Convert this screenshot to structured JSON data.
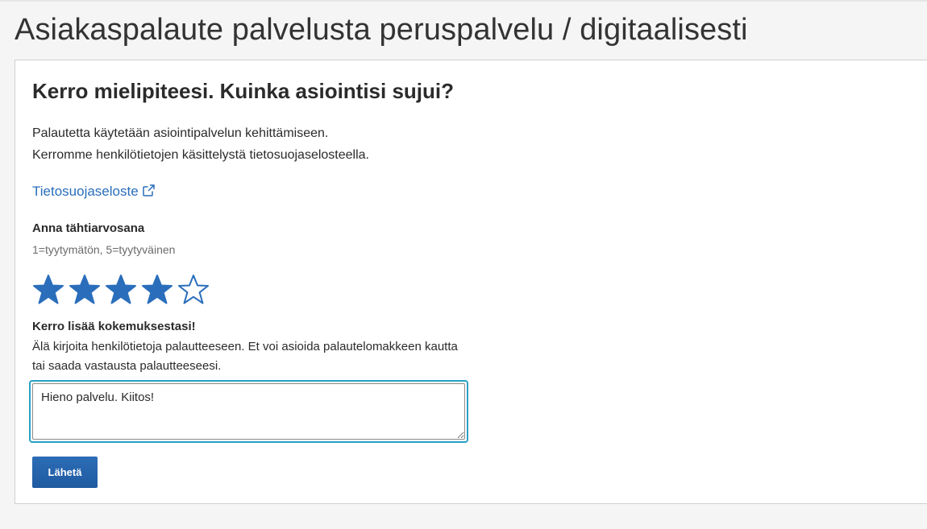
{
  "page": {
    "title": "Asiakaspalaute palvelusta peruspalvelu / digitaalisesti"
  },
  "form": {
    "heading": "Kerro mielipiteesi. Kuinka asiointisi sujui?",
    "intro_lines": [
      "Palautetta käytetään asiointipalvelun kehittämiseen.",
      "Kerromme henkilötietojen käsittelystä tietosuojaselosteella."
    ],
    "privacy_link": "Tietosuojaseloste",
    "rating": {
      "label": "Anna tähtiarvosana",
      "hint": "1=tyytymätön, 5=tyytyväinen",
      "max": 5,
      "value": 4
    },
    "experience": {
      "label": "Kerro lisää kokemuksestasi!",
      "hint_lines": [
        "Älä kirjoita henkilötietoja palautteeseen. Et voi asioida palautelomakkeen kautta",
        "tai saada vastausta palautteeseesi."
      ],
      "value": "Hieno palvelu. Kiitos!"
    },
    "submit_label": "Lähetä"
  },
  "colors": {
    "accent": "#2a6ebb",
    "star_fill": "#2a6ebb",
    "focus_border": "#2aa0c6",
    "button": "#1f5aa0"
  },
  "icons": {
    "link": "external-link-icon",
    "star_filled": "star-filled-icon",
    "star_empty": "star-outline-icon"
  }
}
